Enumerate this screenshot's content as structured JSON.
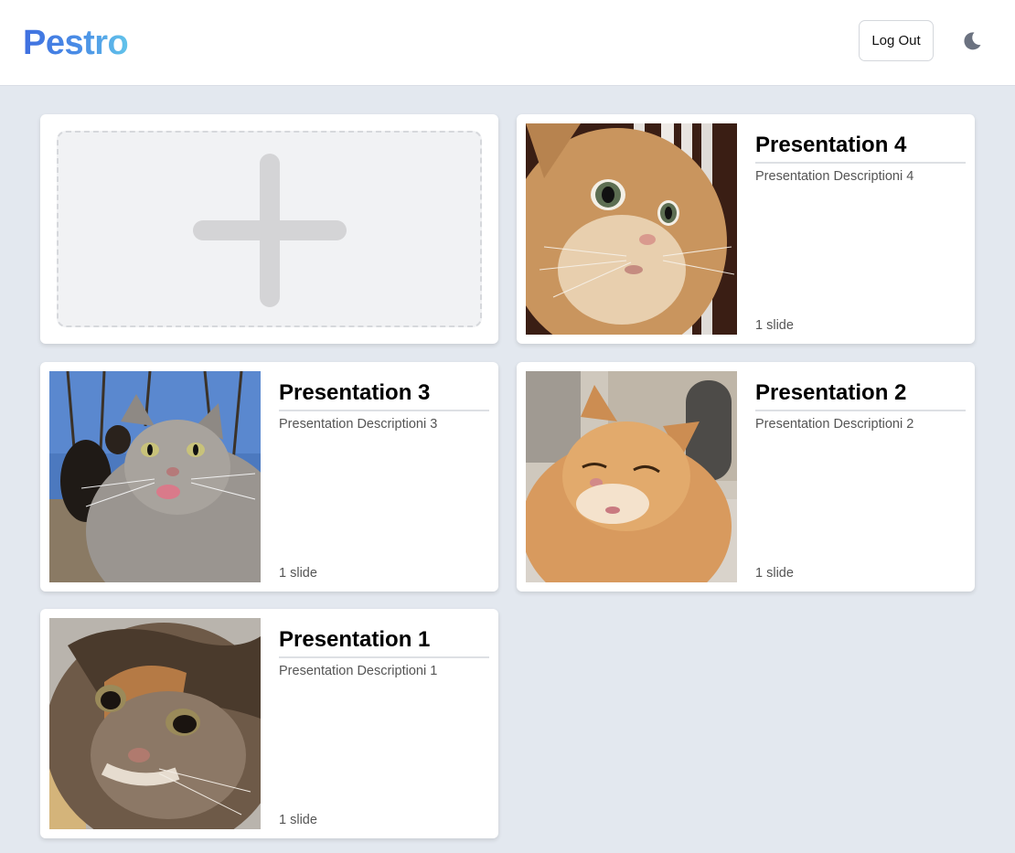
{
  "header": {
    "logo": "Pestro",
    "logout_label": "Log Out",
    "theme_icon": "moon-icon"
  },
  "new_presentation": {
    "icon": "plus-icon"
  },
  "presentations": [
    {
      "title": "Presentation 4",
      "description": "Presentation Descriptioni 4",
      "slides": "1 slide",
      "thumbnail": "startled-orange-cat-photo"
    },
    {
      "title": "Presentation 3",
      "description": "Presentation Descriptioni 3",
      "slides": "1 slide",
      "thumbnail": "grey-tabby-cat-selfie-photo"
    },
    {
      "title": "Presentation 2",
      "description": "Presentation Descriptioni 2",
      "slides": "1 slide",
      "thumbnail": "squinting-ginger-cat-photo"
    },
    {
      "title": "Presentation 1",
      "description": "Presentation Descriptioni 1",
      "slides": "1 slide",
      "thumbnail": "sad-calico-cat-photo"
    }
  ],
  "colors": {
    "page_background": "#e3e8ef",
    "logo_gradient_start": "#3f6fe0",
    "logo_gradient_end": "#62c4ea",
    "card_background": "#ffffff"
  }
}
